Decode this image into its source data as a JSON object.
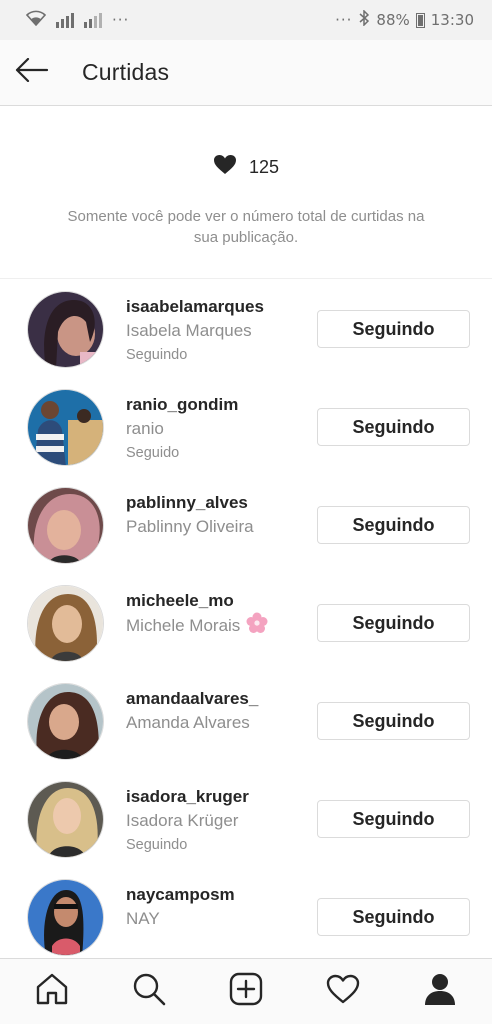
{
  "status_bar": {
    "left_dots": "···",
    "right_dots": "···",
    "battery": "88%",
    "time": "13:30"
  },
  "header": {
    "title": "Curtidas"
  },
  "summary": {
    "likes_count": "125",
    "notice": "Somente você pode ver o número total de curtidas na sua publicação."
  },
  "users": [
    {
      "username": "isaabelamarques",
      "fullname": "Isabela Marques",
      "status": "Seguindo",
      "button": "Seguindo"
    },
    {
      "username": "ranio_gondim",
      "fullname": "ranio",
      "status": "Seguido",
      "button": "Seguindo"
    },
    {
      "username": "pablinny_alves",
      "fullname": "Pablinny Oliveira",
      "status": "",
      "button": "Seguindo"
    },
    {
      "username": "micheele_mo",
      "fullname": "Michele Morais",
      "status": "",
      "button": "Seguindo"
    },
    {
      "username": "amandaalvares_",
      "fullname": "Amanda Alvares",
      "status": "",
      "button": "Seguindo"
    },
    {
      "username": "isadora_kruger",
      "fullname": "Isadora Krüger",
      "status": "Seguindo",
      "button": "Seguindo"
    },
    {
      "username": "naycamposm",
      "fullname": "NAY",
      "status": "",
      "button": "Seguindo"
    }
  ],
  "colors": {
    "text_primary": "#262626",
    "text_secondary": "#8e8e8e",
    "border": "#dbdbdb"
  },
  "icons": {
    "tabs": [
      "home-icon",
      "search-icon",
      "new-post-icon",
      "activity-heart-icon",
      "profile-icon"
    ]
  }
}
